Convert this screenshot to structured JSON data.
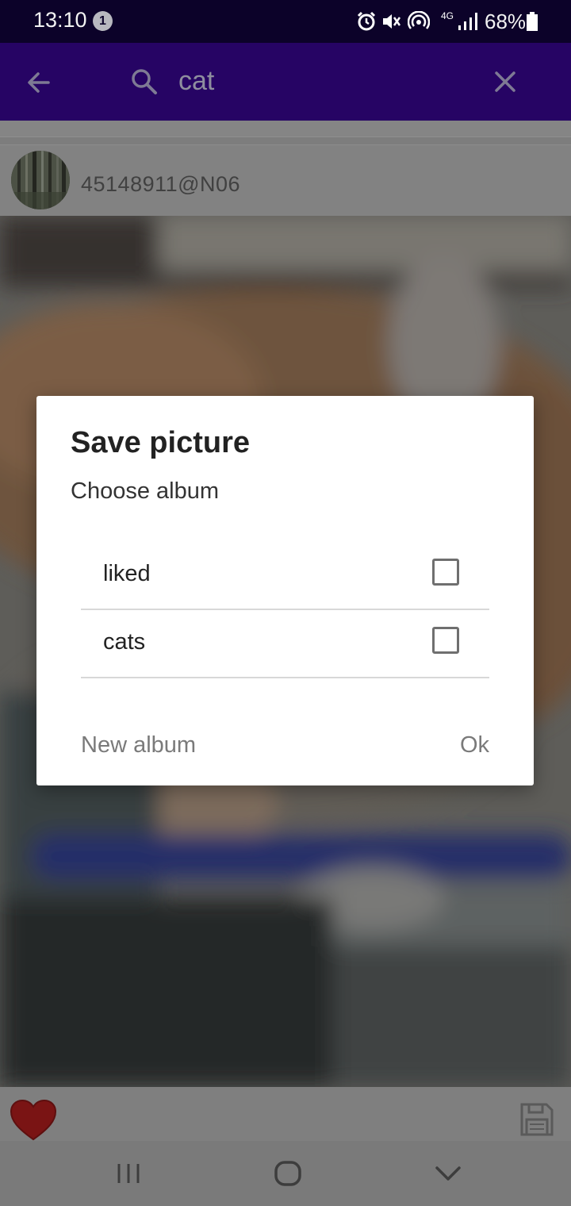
{
  "status_bar": {
    "time": "13:10",
    "notification_count": "1",
    "network": "4G",
    "battery": "68%"
  },
  "app_bar": {
    "search_query": "cat"
  },
  "photo": {
    "owner": "45148911@N06"
  },
  "dialog": {
    "title": "Save picture",
    "subtitle": "Choose album",
    "albums": [
      {
        "label": "liked",
        "checked": false
      },
      {
        "label": "cats",
        "checked": false
      }
    ],
    "new_album_label": "New album",
    "ok_label": "Ok"
  },
  "colors": {
    "status_bar": "#0c0229",
    "app_bar": "#260464",
    "heart": "#7a1414"
  }
}
